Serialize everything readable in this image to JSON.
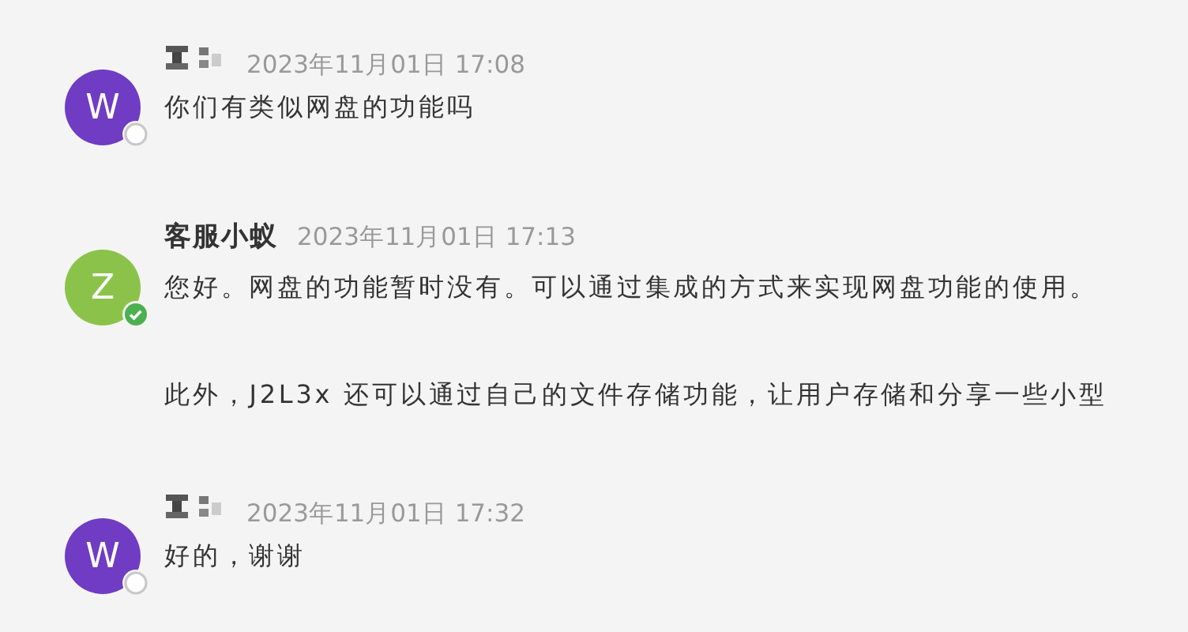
{
  "messages": [
    {
      "avatar": "W",
      "color": "#6f3cc3",
      "online": false,
      "kind": "redacted",
      "time": "2023年11月01日 17:08",
      "paragraphs": [
        "你们有类似网盘的功能吗"
      ]
    },
    {
      "avatar": "Z",
      "color": "#8bc34a",
      "online": true,
      "kind": "text",
      "name": "客服小蚁",
      "time": "2023年11月01日 17:13",
      "paragraphs": [
        "您好。网盘的功能暂时没有。可以通过集成的方式来实现网盘功能的使用。",
        "此外，J2L3x 还可以通过自己的文件存储功能，让用户存储和分享一些小型"
      ]
    },
    {
      "avatar": "W",
      "color": "#6f3cc3",
      "online": false,
      "kind": "redacted",
      "time": "2023年11月01日 17:32",
      "paragraphs": [
        "好的，谢谢"
      ]
    }
  ]
}
